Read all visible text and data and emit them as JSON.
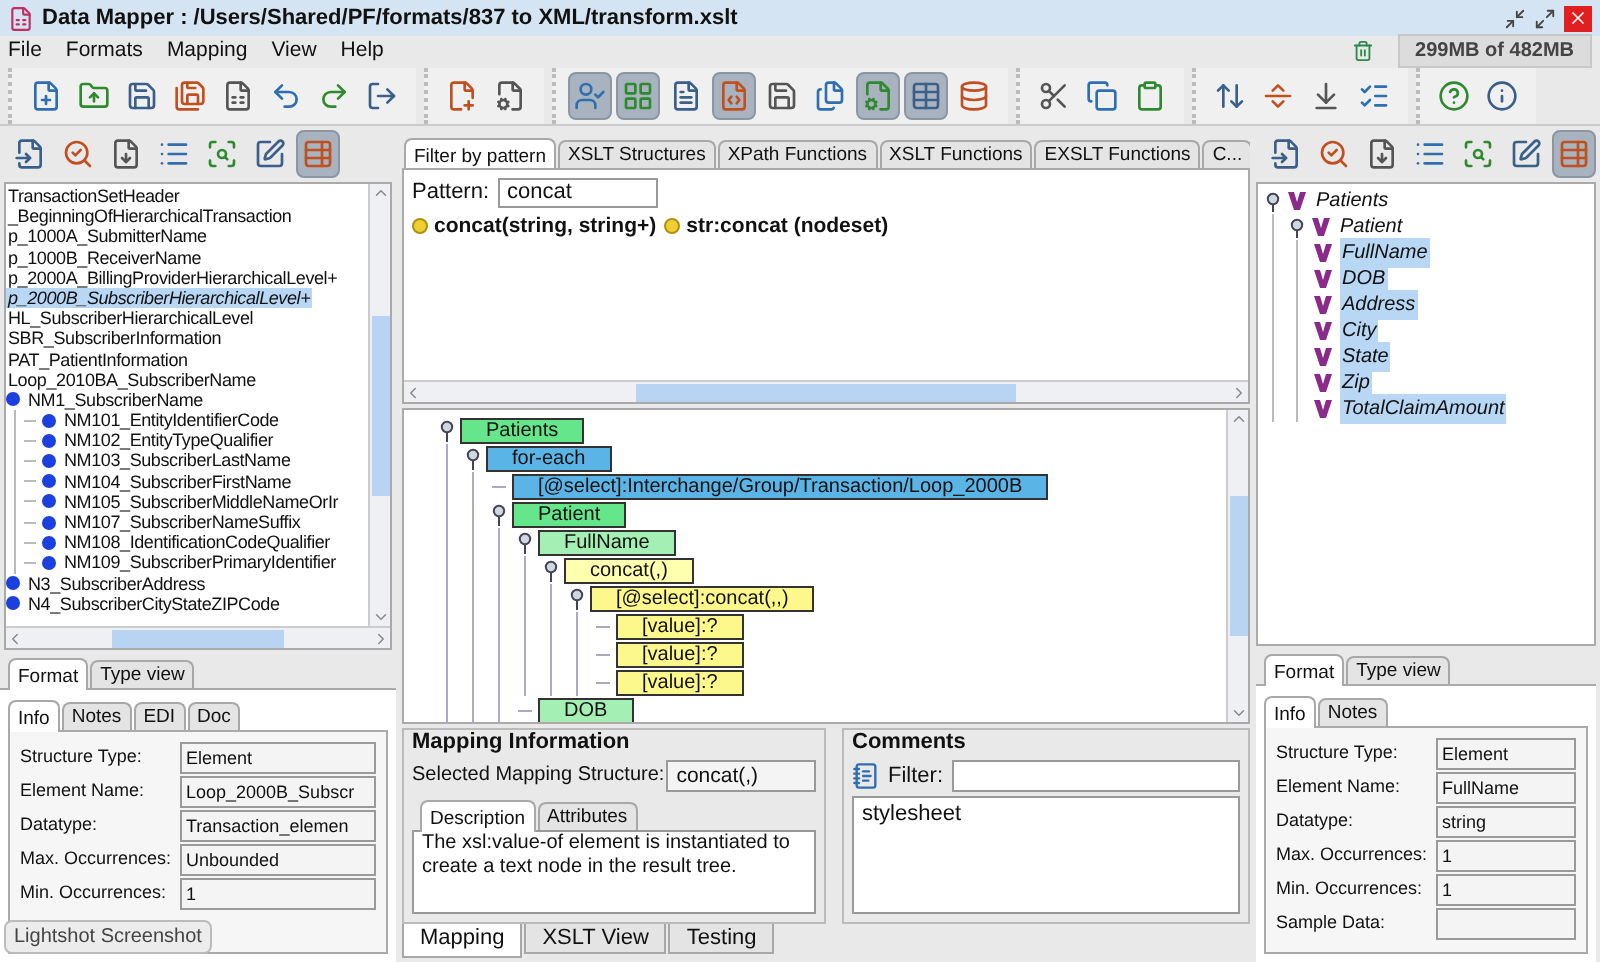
{
  "window": {
    "title": "Data Mapper : /Users/Shared/PF/formats/837 to XML/transform.xslt"
  },
  "menu": [
    "File",
    "Formats",
    "Mapping",
    "View",
    "Help"
  ],
  "memory": "299MB of 482MB",
  "main_toolbar": [
    {
      "pressed": false
    },
    {
      "pressed": false
    },
    {
      "pressed": false
    },
    {
      "pressed": false
    },
    {
      "pressed": false
    },
    {
      "pressed": false
    },
    {
      "pressed": false
    },
    {
      "pressed": false
    },
    {
      "pressed": false
    },
    {
      "pressed": false
    },
    {
      "pressed": true
    },
    {
      "pressed": true
    },
    {
      "pressed": false
    },
    {
      "pressed": true
    },
    {
      "pressed": false
    },
    {
      "pressed": false
    },
    {
      "pressed": true
    },
    {
      "pressed": true
    },
    {
      "pressed": false
    },
    {
      "pressed": false
    },
    {
      "pressed": false
    },
    {
      "pressed": false
    },
    {
      "pressed": false
    },
    {
      "pressed": false
    },
    {
      "pressed": false
    },
    {
      "pressed": false
    },
    {
      "pressed": false
    },
    {
      "pressed": false
    }
  ],
  "left_panel": {
    "toolbar": [
      {
        "pressed": false
      },
      {
        "pressed": false
      },
      {
        "pressed": false
      },
      {
        "pressed": false
      },
      {
        "pressed": false
      },
      {
        "pressed": false
      },
      {
        "pressed": true
      }
    ],
    "tree": [
      {
        "label": "TransactionSetHeader",
        "kind": "segment",
        "selected": false
      },
      {
        "label": "_BeginningOfHierarchicalTransaction",
        "kind": "segment",
        "selected": false
      },
      {
        "label": "p_1000A_SubmitterName",
        "kind": "segment",
        "selected": false
      },
      {
        "label": "p_1000B_ReceiverName",
        "kind": "segment",
        "selected": false
      },
      {
        "label": "p_2000A_BillingProviderHierarchicalLevel+",
        "kind": "segment",
        "selected": false
      },
      {
        "label": "p_2000B_SubscriberHierarchicalLevel+",
        "kind": "segment",
        "selected": true
      },
      {
        "label": "HL_SubscriberHierarchicalLevel",
        "kind": "segment",
        "selected": false
      },
      {
        "label": "SBR_SubscriberInformation",
        "kind": "segment",
        "selected": false
      },
      {
        "label": "PAT_PatientInformation",
        "kind": "segment",
        "selected": false
      },
      {
        "label": "Loop_2010BA_SubscriberName",
        "kind": "segment",
        "selected": false
      },
      {
        "label": "NM1_SubscriberName",
        "kind": "element",
        "selected": false,
        "children": [
          {
            "label": "NM101_EntityIdentifierCode",
            "kind": "element",
            "selected": false
          },
          {
            "label": "NM102_EntityTypeQualifier",
            "kind": "element",
            "selected": false
          },
          {
            "label": "NM103_SubscriberLastName",
            "kind": "element",
            "selected": false
          },
          {
            "label": "NM104_SubscriberFirstName",
            "kind": "element",
            "selected": false
          },
          {
            "label": "NM105_SubscriberMiddleNameOrIr",
            "kind": "element",
            "selected": false
          },
          {
            "label": "NM107_SubscriberNameSuffix",
            "kind": "element",
            "selected": false
          },
          {
            "label": "NM108_IdentificationCodeQualifier",
            "kind": "element",
            "selected": false
          },
          {
            "label": "NM109_SubscriberPrimaryIdentifier",
            "kind": "element",
            "selected": false
          }
        ]
      },
      {
        "label": "N3_SubscriberAddress",
        "kind": "element",
        "selected": false
      },
      {
        "label": "N4_SubscriberCityStateZIPCode",
        "kind": "element",
        "selected": false
      }
    ],
    "view_tabs": [
      {
        "label": "Format",
        "selected": true
      },
      {
        "label": "Type view",
        "selected": false
      }
    ],
    "info_tabs": [
      {
        "label": "Info",
        "selected": true
      },
      {
        "label": "Notes",
        "selected": false
      },
      {
        "label": "EDI",
        "selected": false
      },
      {
        "label": "Doc",
        "selected": false
      }
    ],
    "fields": [
      {
        "label": "Structure Type:",
        "value": "Element"
      },
      {
        "label": "Element Name:",
        "value": "Loop_2000B_Subscr"
      },
      {
        "label": "Datatype:",
        "value": "Transaction_elemen"
      },
      {
        "label": "Max. Occurrences:",
        "value": "Unbounded"
      },
      {
        "label": "Min. Occurrences:",
        "value": "1"
      }
    ],
    "tooltip": "Lightshot Screenshot"
  },
  "center": {
    "palette_tabs": [
      {
        "label": "Filter by pattern",
        "selected": true
      },
      {
        "label": "XSLT Structures",
        "selected": false
      },
      {
        "label": "XPath Functions",
        "selected": false
      },
      {
        "label": "XSLT Functions",
        "selected": false
      },
      {
        "label": "EXSLT Functions",
        "selected": false
      },
      {
        "label": "C...",
        "selected": false
      }
    ],
    "pattern": {
      "label": "Pattern:",
      "value": "concat"
    },
    "functions": [
      "concat(string, string+)",
      "str:concat (nodeset)"
    ],
    "mapping": [
      {
        "label": "Patients",
        "color": "#66e68a",
        "children": [
          {
            "label": "for-each",
            "color": "#5ab4e6",
            "children": [
              {
                "label": "[@select]:Interchange/Group/Transaction/Loop_2000B",
                "color": "#5ab4e6"
              },
              {
                "label": "Patient",
                "color": "#66e68a",
                "children": [
                  {
                    "label": "FullName",
                    "color": "#a4f0b4",
                    "children": [
                      {
                        "label": "concat(,)",
                        "color": "#ffffb0",
                        "children": [
                          {
                            "label": "[@select]:concat(,,)",
                            "color": "#fcf88c",
                            "children": [
                              {
                                "label": "[value]:?",
                                "color": "#fcf88c"
                              },
                              {
                                "label": "[value]:?",
                                "color": "#fcf88c"
                              },
                              {
                                "label": "[value]:?",
                                "color": "#fcf88c"
                              }
                            ]
                          }
                        ]
                      }
                    ]
                  },
                  {
                    "label": "DOB",
                    "color": "#a4f0b4"
                  }
                ]
              }
            ]
          }
        ]
      }
    ],
    "info": {
      "title": "Mapping Information",
      "selected_label": "Selected Mapping Structure:",
      "selected_value": "concat(,)",
      "tabs": [
        {
          "label": "Description",
          "selected": true
        },
        {
          "label": "Attributes",
          "selected": false
        }
      ],
      "description": "The xsl:value-of element is instantiated to create a text node in the result tree."
    },
    "comments": {
      "title": "Comments",
      "filter_label": "Filter:",
      "items": [
        "stylesheet"
      ]
    },
    "bottom_tabs": [
      {
        "label": "Mapping",
        "selected": true
      },
      {
        "label": "XSLT View",
        "selected": false
      },
      {
        "label": "Testing",
        "selected": false
      }
    ]
  },
  "right_panel": {
    "toolbar": [
      {
        "pressed": false
      },
      {
        "pressed": false
      },
      {
        "pressed": false
      },
      {
        "pressed": false
      },
      {
        "pressed": false
      },
      {
        "pressed": false
      },
      {
        "pressed": true
      }
    ],
    "tree": [
      {
        "label": "Patients",
        "selected": false,
        "children": [
          {
            "label": "Patient",
            "selected": false,
            "children": [
              {
                "label": "FullName",
                "selected": true
              },
              {
                "label": "DOB",
                "selected": true
              },
              {
                "label": "Address",
                "selected": true
              },
              {
                "label": "City",
                "selected": true
              },
              {
                "label": "State",
                "selected": true
              },
              {
                "label": "Zip",
                "selected": true
              },
              {
                "label": "TotalClaimAmount",
                "selected": true
              }
            ]
          }
        ]
      }
    ],
    "view_tabs": [
      {
        "label": "Format",
        "selected": true
      },
      {
        "label": "Type view",
        "selected": false
      }
    ],
    "info_tabs": [
      {
        "label": "Info",
        "selected": true
      },
      {
        "label": "Notes",
        "selected": false
      }
    ],
    "fields": [
      {
        "label": "Structure Type:",
        "value": "Element"
      },
      {
        "label": "Element Name:",
        "value": "FullName"
      },
      {
        "label": "Datatype:",
        "value": "string"
      },
      {
        "label": "Max. Occurrences:",
        "value": "1"
      },
      {
        "label": "Min. Occurrences:",
        "value": "1"
      },
      {
        "label": "Sample Data:"
      }
    ]
  }
}
